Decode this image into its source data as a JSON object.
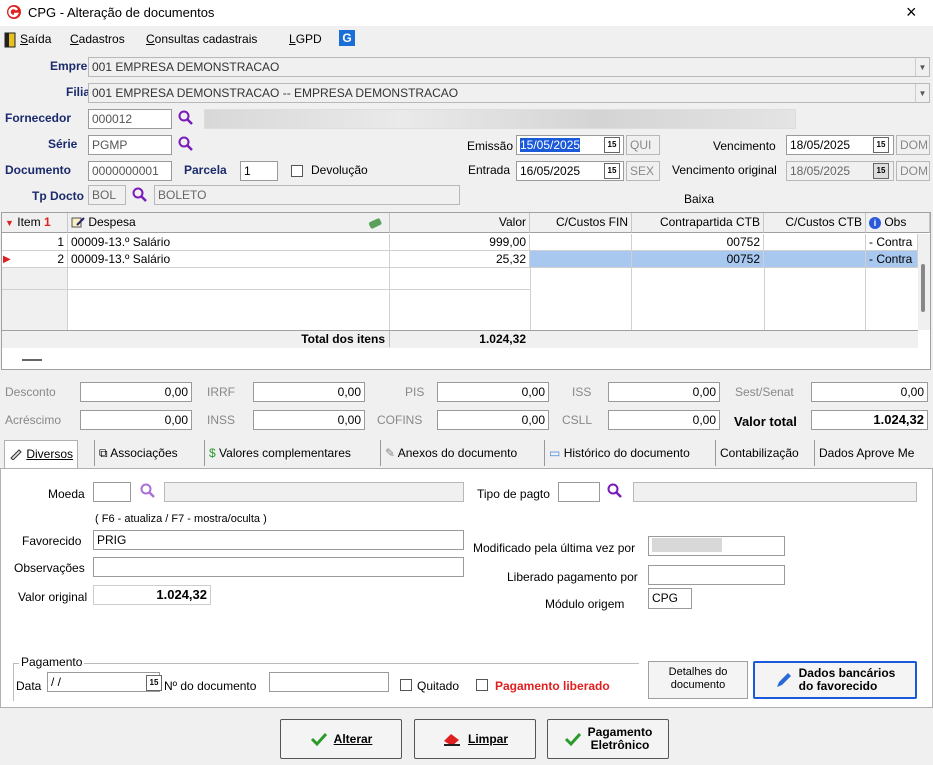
{
  "window": {
    "title": "CPG - Alteração de documentos",
    "close": "×"
  },
  "menu": {
    "items": [
      "Saída",
      "Cadastros",
      "Consultas cadastrais",
      "LGPD"
    ],
    "logo": "G"
  },
  "header": {
    "empresa_label": "Empresa",
    "empresa_value": "001 EMPRESA DEMONSTRACAO",
    "filial_label": "Filial",
    "filial_value": "001 EMPRESA DEMONSTRACAO -- EMPRESA DEMONSTRACAO",
    "fornecedor_label": "Fornecedor",
    "fornecedor_value": "000012",
    "serie_label": "Série",
    "serie_value": "PGMP",
    "documento_label": "Documento",
    "documento_value": "0000000001",
    "parcela_label": "Parcela",
    "parcela_value": "1",
    "devolucao_label": "Devolução",
    "tpdocto_label": "Tp Docto",
    "tpdocto_code": "BOL",
    "tpdocto_desc": "BOLETO",
    "emissao_label": "Emissão",
    "emissao_value": "15/05/2025",
    "emissao_day": "QUI",
    "entrada_label": "Entrada",
    "entrada_value": "16/05/2025",
    "entrada_day": "SEX",
    "vencimento_label": "Vencimento",
    "vencimento_value": "18/05/2025",
    "vencimento_day": "DOM",
    "venc_orig_label": "Vencimento original",
    "venc_orig_value": "18/05/2025",
    "venc_orig_day": "DOM",
    "baixa_label": "Baixa",
    "cal_glyph": "15"
  },
  "grid": {
    "columns": [
      "Item",
      "Despesa",
      "Valor",
      "C/Custos FIN",
      "Contrapartida CTB",
      "C/Custos CTB",
      "Obs"
    ],
    "rows": [
      {
        "item": "1",
        "despesa": "00009-13.º Salário",
        "valor": "999,00",
        "cc_fin": "",
        "contrapartida": "00752",
        "cc_ctb": "",
        "obs": "- Contra"
      },
      {
        "item": "2",
        "despesa": "00009-13.º Salário",
        "valor": "25,32",
        "cc_fin": "",
        "contrapartida": "00752",
        "cc_ctb": "",
        "obs": "- Contra"
      }
    ],
    "total_label": "Total dos itens",
    "total_value": "1.024,32"
  },
  "totals": {
    "desconto_label": "Desconto",
    "desconto": "0,00",
    "irrf_label": "IRRF",
    "irrf": "0,00",
    "pis_label": "PIS",
    "pis": "0,00",
    "iss_label": "ISS",
    "iss": "0,00",
    "sest_label": "Sest/Senat",
    "sest": "0,00",
    "acrescimo_label": "Acréscimo",
    "acrescimo": "0,00",
    "inss_label": "INSS",
    "inss": "0,00",
    "cofins_label": "COFINS",
    "cofins": "0,00",
    "csll_label": "CSLL",
    "csll": "0,00",
    "valor_total_label": "Valor total",
    "valor_total": "1.024,32"
  },
  "tabs": [
    "Diversos",
    "Associações",
    "Valores complementares",
    "Anexos do documento",
    "Histórico do documento",
    "Contabilização",
    "Dados Aprove Me"
  ],
  "diversos": {
    "moeda_label": "Moeda",
    "tipo_pagto_label": "Tipo de pagto",
    "hint": "( F6 - atualiza / F7 - mostra/oculta )",
    "favorecido_label": "Favorecido",
    "favorecido_value": "PRIG",
    "observacoes_label": "Observações",
    "valor_original_label": "Valor original",
    "valor_original_value": "1.024,32",
    "modificado_label": "Modificado pela última vez por",
    "liberado_label": "Liberado pagamento por",
    "modulo_label": "Módulo origem",
    "modulo_value": "CPG",
    "pagamento_group": "Pagamento",
    "data_label": "Data",
    "data_value": " /  / ",
    "ndoc_label": "Nº do documento",
    "quitado_label": "Quitado",
    "pag_liberado_label": "Pagamento liberado",
    "detalhes_btn_l1": "Detalhes do",
    "detalhes_btn_l2": "documento",
    "dados_btn_l1": "Dados bancários",
    "dados_btn_l2": "do favorecido"
  },
  "footer": {
    "alterar": "Alterar",
    "limpar": "Limpar",
    "pag_l1": "Pagamento",
    "pag_l2": "Eletrônico"
  },
  "colors": {
    "accent": "#1a2a6c",
    "selection": "#a8c8f0",
    "danger": "#e02020",
    "check": "#2a9a2a"
  }
}
